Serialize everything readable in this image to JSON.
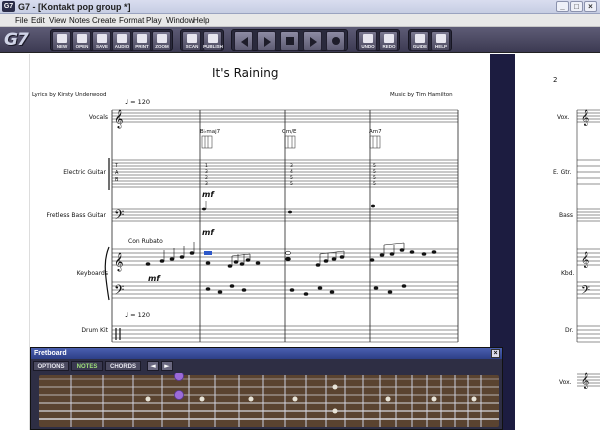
{
  "window": {
    "app_icon": "G7",
    "title": "G7 - [Kontakt pop group *]",
    "minimize": "_",
    "maximize": "□",
    "close": "×"
  },
  "menu": [
    "File",
    "Edit",
    "View",
    "Notes",
    "Create",
    "Format",
    "Play",
    "Window",
    "Help"
  ],
  "toolbar": {
    "logo": "G7",
    "file_buttons": [
      "NEW",
      "OPEN",
      "SAVE",
      "AUDIO",
      "PRINT",
      "ZOOM"
    ],
    "scan_buttons": [
      "SCAN",
      "PUBLISH"
    ],
    "transport_icons": [
      "rewind-icon",
      "fast-forward-icon",
      "stop-icon",
      "play-icon",
      "record-icon"
    ],
    "edit_buttons": [
      "UNDO",
      "REDO"
    ],
    "help_buttons": [
      "GUIDE",
      "HELP"
    ]
  },
  "score": {
    "title": "It's Raining",
    "lyricist": "Lyrics by Kirsty Underwood",
    "composer": "Music by Tim Hamilton",
    "tempo_top": "♩ = 120",
    "tempo_bottom": "♩ = 120",
    "instruments": [
      "Vocals",
      "Electric Guitar",
      "Fretless Bass Guitar",
      "Keyboards",
      "Drum Kit"
    ],
    "chords": [
      "B♭maj7",
      "Cm/E",
      "Am7"
    ],
    "dynamics": [
      "mf",
      "mf",
      "mf"
    ],
    "expression": "Con Rubato",
    "page2_number": "2",
    "page2_instruments": [
      "Vox.",
      "E. Gtr.",
      "Bass",
      "Kbd.",
      "Dr.",
      "Vox."
    ]
  },
  "fretboard": {
    "title": "Fretboard",
    "close": "×",
    "tabs": [
      "OPTIONS",
      "NOTES",
      "CHORDS"
    ],
    "active_tab": "NOTES",
    "arrows": [
      "◄",
      "►"
    ]
  },
  "colors": {
    "toolbar": "#4a4862",
    "workspace": "#1c1c40",
    "fretboard_wood": "#5a4330",
    "active_note": "#9b6bd9",
    "fretboard_title": "#3a4fa0"
  }
}
